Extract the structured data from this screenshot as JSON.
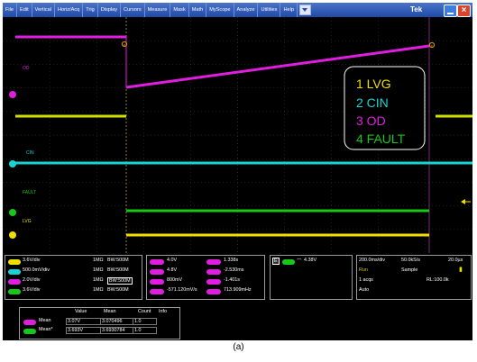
{
  "menubar": {
    "items": [
      "File",
      "Edit",
      "Vertical",
      "Horiz/Acq",
      "Trig",
      "Display",
      "Cursors",
      "Measure",
      "Mask",
      "Math",
      "MyScope",
      "Analyze",
      "Utilities",
      "Help"
    ],
    "brand": "Tek"
  },
  "colors": {
    "ch1": "#f0e000",
    "ch2": "#19d2d2",
    "ch3": "#e01ee0",
    "ch4": "#18c818",
    "grid": "#4a4a4a",
    "cursor": "#9a2e9a"
  },
  "plot": {
    "channel_tags": [
      "OD",
      "CIN",
      "FAULT",
      "LVG"
    ],
    "legend": [
      "1 LVG",
      "2 CIN",
      "3 OD",
      "4 FAULT"
    ],
    "cursor_marker": "a",
    "marker_b": "b"
  },
  "channel_settings": [
    {
      "ch": "C1",
      "scale": "3.6V/div",
      "coupling": "1MΩ",
      "bw": "BW:500M",
      "color": "#f0e000"
    },
    {
      "ch": "C2",
      "scale": "500.0mV/div",
      "coupling": "1MΩ",
      "bw": "BW:500M",
      "color": "#19d2d2"
    },
    {
      "ch": "C3",
      "scale": "2.0V/div",
      "coupling": "1MΩ",
      "bw": "BW:500M",
      "color": "#e01ee0"
    },
    {
      "ch": "C4",
      "scale": "3.6V/div",
      "coupling": "1MΩ",
      "bw": "BW:500M",
      "color": "#18c818"
    }
  ],
  "cursors": {
    "left": [
      {
        "tag": "C1",
        "value": "4.0V",
        "color": "#e01ee0"
      },
      {
        "tag": "C2",
        "value": "4.8V",
        "color": "#e01ee0"
      },
      {
        "tag": "ΔV",
        "value": "800mV",
        "color": "#e01ee0"
      },
      {
        "tag": "dV/dt",
        "value": "-571.120mV/s",
        "color": "#e01ee0"
      }
    ],
    "right": [
      {
        "tag": "t1",
        "value": "1.338s",
        "color": "#e01ee0"
      },
      {
        "tag": "t2",
        "value": "-2.530ms",
        "color": "#e01ee0"
      },
      {
        "tag": "Δt",
        "value": "-1.401s",
        "color": "#e01ee0"
      },
      {
        "tag": "1/Δt",
        "value": "713.909mHz",
        "color": "#e01ee0"
      }
    ]
  },
  "trigger": {
    "source": "C4",
    "level": "4.38V",
    "color": "#18c818"
  },
  "timebase": {
    "scale": "200.0ms/div",
    "rate": "50.0kS/s",
    "res": "20.0µs",
    "state": "Run",
    "mode": "Sample",
    "acqs": "1 acqs",
    "rl": "RL:100.0k",
    "trig_mode": "Auto"
  },
  "measurements": {
    "headers": [
      "Value",
      "Mean",
      "Count",
      "Info"
    ],
    "rows": [
      {
        "ch": "C3",
        "name": "Mean",
        "value": "3.07V",
        "mean": "3.070496",
        "count": "1.0",
        "color": "#e01ee0"
      },
      {
        "ch": "C4",
        "name": "Mean*",
        "value": "3.693V",
        "mean": "3.6930784",
        "count": "1.0",
        "color": "#18c818"
      }
    ]
  },
  "caption": "(a)"
}
